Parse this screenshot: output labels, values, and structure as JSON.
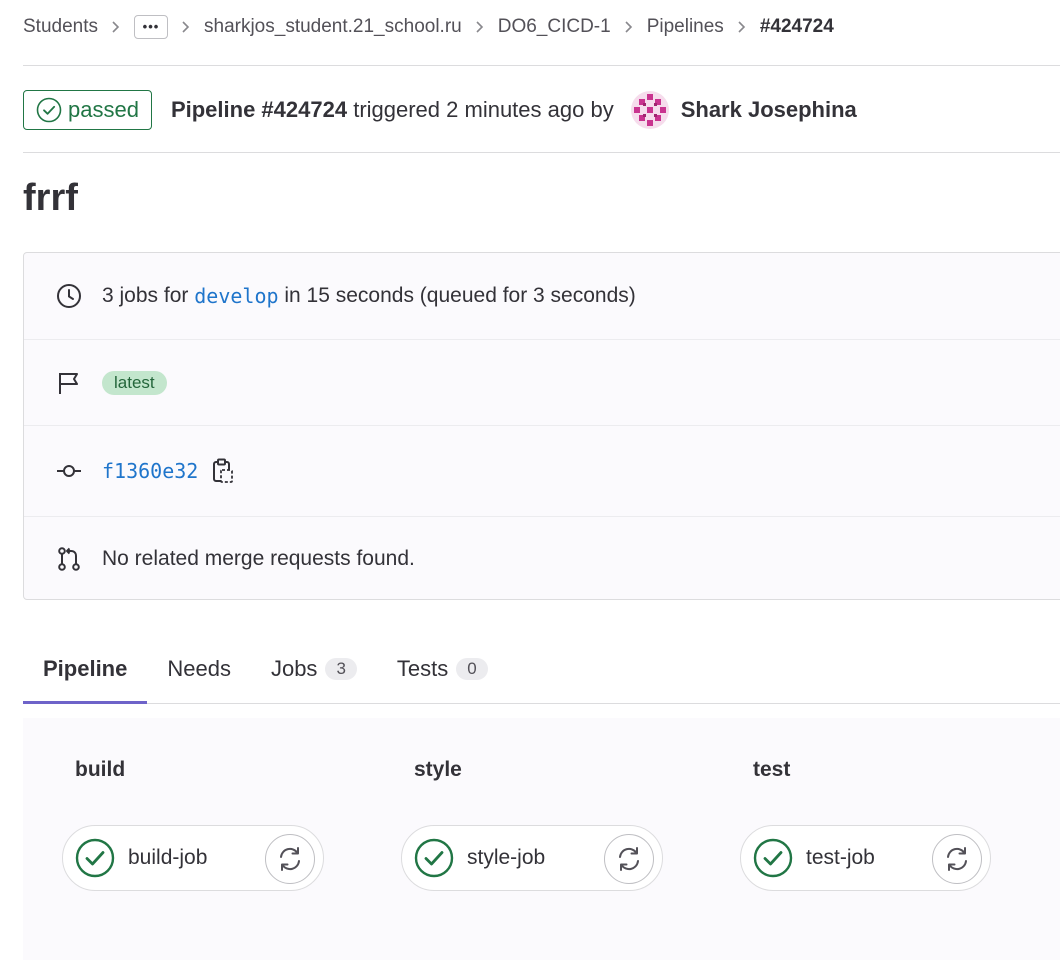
{
  "breadcrumb": {
    "items": [
      "Students",
      "sharkjos_student.21_school.ru",
      "DO6_CICD-1",
      "Pipelines",
      "#424724"
    ],
    "more_label": "•••"
  },
  "header": {
    "status_label": "passed",
    "pipeline_label": "Pipeline #424724",
    "triggered_text": "triggered 2 minutes ago by",
    "author": "Shark Josephina"
  },
  "title": "frrf",
  "info": {
    "jobs_prefix": "3 jobs for",
    "branch": "develop",
    "duration_text": "in 15 seconds (queued for 3 seconds)",
    "tag": "latest",
    "commit_sha": "f1360e32",
    "merge_requests_text": "No related merge requests found."
  },
  "tabs": [
    {
      "label": "Pipeline",
      "count": null
    },
    {
      "label": "Needs",
      "count": null
    },
    {
      "label": "Jobs",
      "count": "3"
    },
    {
      "label": "Tests",
      "count": "0"
    }
  ],
  "stages": [
    {
      "name": "build",
      "job": "build-job",
      "status": "success"
    },
    {
      "name": "style",
      "job": "style-job",
      "status": "success"
    },
    {
      "name": "test",
      "job": "test-job",
      "status": "success"
    }
  ],
  "colors": {
    "success": "#217645",
    "link": "#1f75cb",
    "tab_active": "#6e63c9",
    "tag_bg": "#c3e6cd"
  },
  "icons": {
    "status": "check-circle-icon",
    "duration": "clock-icon",
    "tag": "flag-icon",
    "commit": "commit-icon",
    "merge": "merge-request-icon",
    "copy": "copy-to-clipboard-icon",
    "retry": "retry-icon"
  }
}
